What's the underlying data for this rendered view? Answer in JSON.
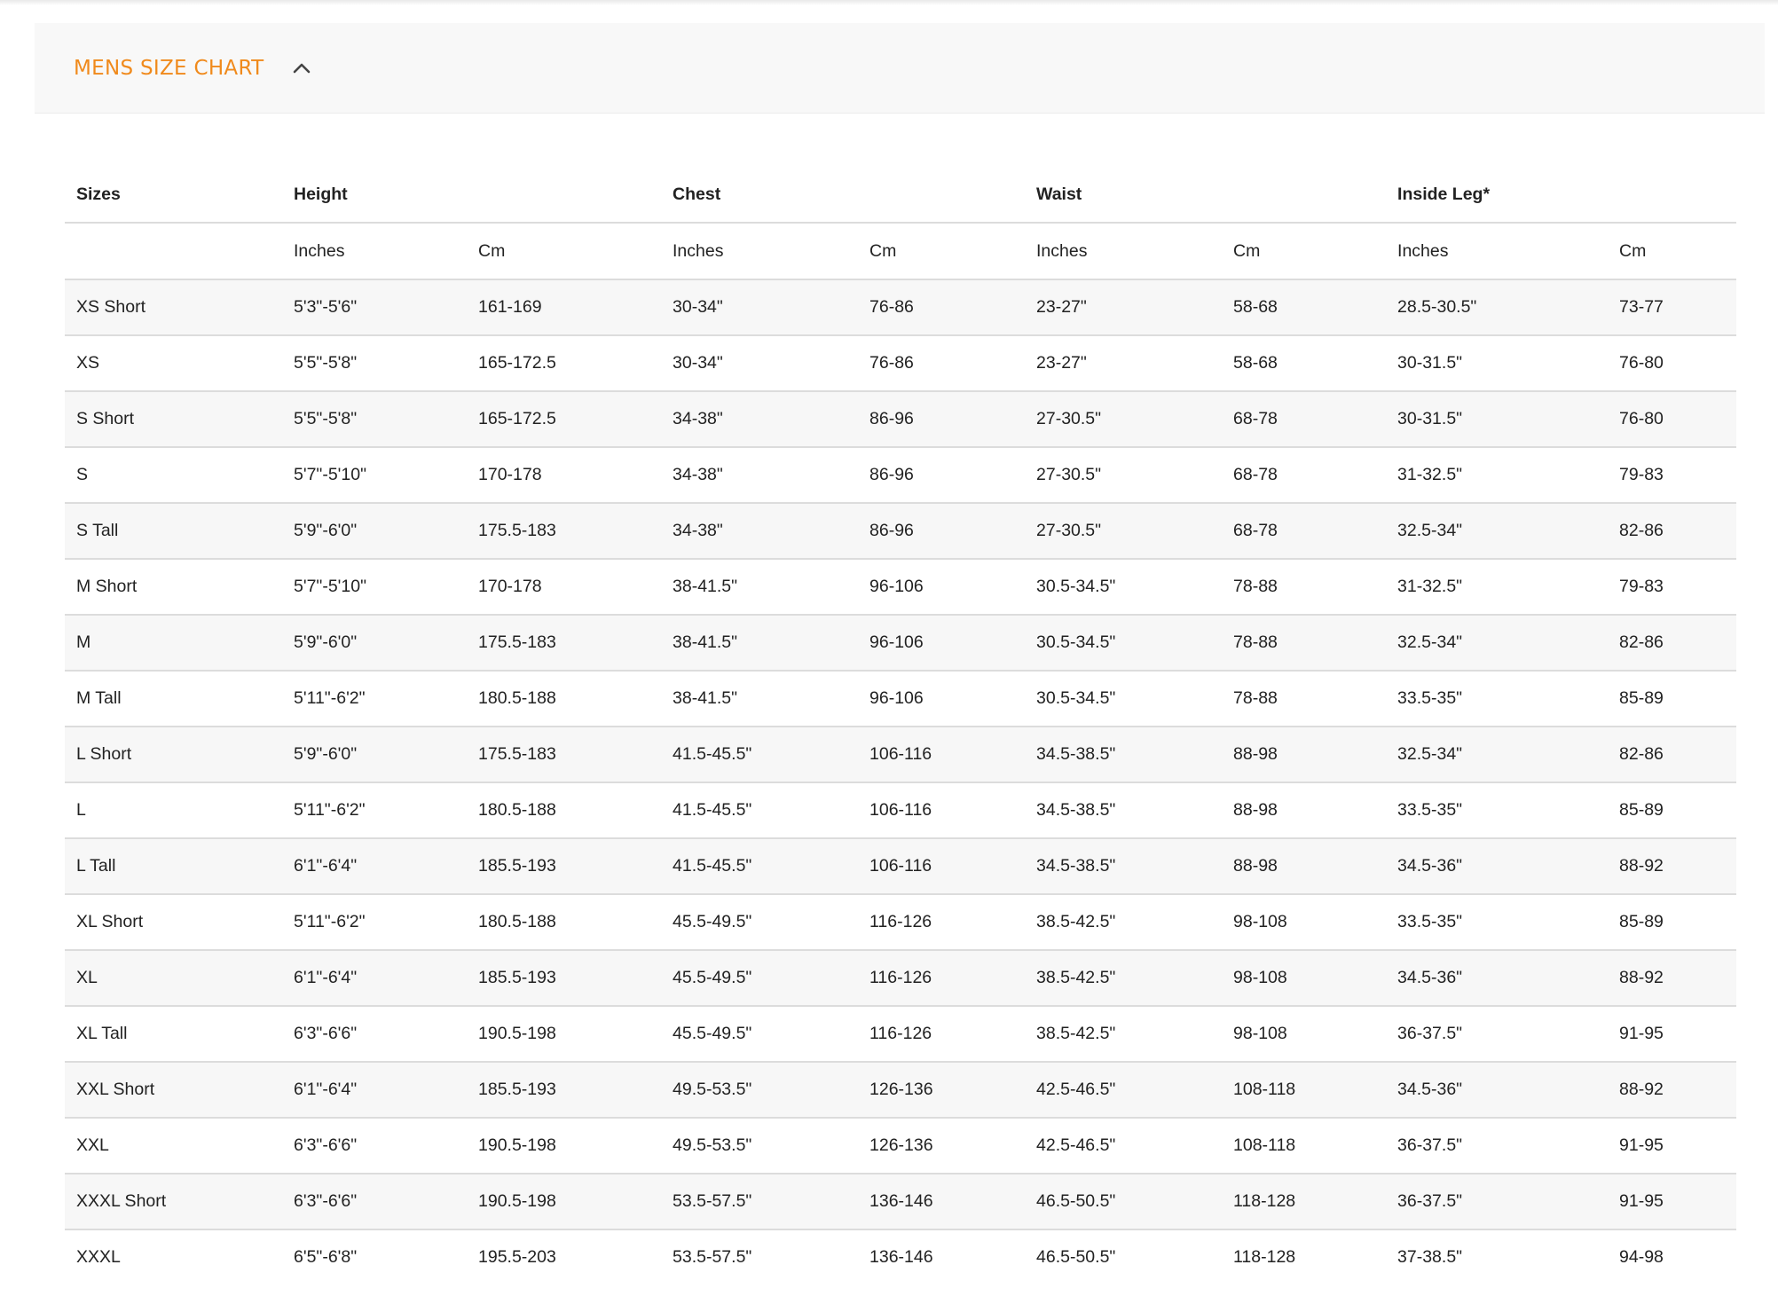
{
  "accordion": {
    "title": "MENS SIZE CHART",
    "expanded_icon": "chevron-up-icon",
    "accent_color": "#f08a1c"
  },
  "table": {
    "headers": {
      "sizes": "Sizes",
      "height": "Height",
      "chest": "Chest",
      "waist": "Waist",
      "inside_leg": "Inside Leg*"
    },
    "units": [
      "",
      "Inches",
      "Cm",
      "Inches",
      "Cm",
      "Inches",
      "Cm",
      "Inches",
      "Cm"
    ],
    "rows": [
      [
        "XS Short",
        "5'3\"-5'6\"",
        "161-169",
        "30-34\"",
        "76-86",
        "23-27\"",
        "58-68",
        "28.5-30.5\"",
        "73-77"
      ],
      [
        "XS",
        "5'5\"-5'8\"",
        "165-172.5",
        "30-34\"",
        "76-86",
        "23-27\"",
        "58-68",
        "30-31.5\"",
        "76-80"
      ],
      [
        "S Short",
        "5'5\"-5'8\"",
        "165-172.5",
        "34-38\"",
        "86-96",
        "27-30.5\"",
        "68-78",
        "30-31.5\"",
        "76-80"
      ],
      [
        "S",
        "5'7\"-5'10\"",
        "170-178",
        "34-38\"",
        "86-96",
        "27-30.5\"",
        "68-78",
        "31-32.5\"",
        "79-83"
      ],
      [
        "S Tall",
        "5'9\"-6'0\"",
        "175.5-183",
        "34-38\"",
        "86-96",
        "27-30.5\"",
        "68-78",
        "32.5-34\"",
        "82-86"
      ],
      [
        "M Short",
        "5'7\"-5'10\"",
        "170-178",
        "38-41.5\"",
        "96-106",
        "30.5-34.5\"",
        "78-88",
        "31-32.5\"",
        "79-83"
      ],
      [
        "M",
        "5'9\"-6'0\"",
        "175.5-183",
        "38-41.5\"",
        "96-106",
        "30.5-34.5\"",
        "78-88",
        "32.5-34\"",
        "82-86"
      ],
      [
        "M Tall",
        "5'11\"-6'2\"",
        "180.5-188",
        "38-41.5\"",
        "96-106",
        "30.5-34.5\"",
        "78-88",
        "33.5-35\"",
        "85-89"
      ],
      [
        "L Short",
        "5'9\"-6'0\"",
        "175.5-183",
        "41.5-45.5\"",
        "106-116",
        "34.5-38.5\"",
        "88-98",
        "32.5-34\"",
        "82-86"
      ],
      [
        "L",
        "5'11\"-6'2\"",
        "180.5-188",
        "41.5-45.5\"",
        "106-116",
        "34.5-38.5\"",
        "88-98",
        "33.5-35\"",
        "85-89"
      ],
      [
        "L Tall",
        "6'1\"-6'4\"",
        "185.5-193",
        "41.5-45.5\"",
        "106-116",
        "34.5-38.5\"",
        "88-98",
        "34.5-36\"",
        "88-92"
      ],
      [
        "XL Short",
        "5'11\"-6'2\"",
        "180.5-188",
        "45.5-49.5\"",
        "116-126",
        "38.5-42.5\"",
        "98-108",
        "33.5-35\"",
        "85-89"
      ],
      [
        "XL",
        "6'1\"-6'4\"",
        "185.5-193",
        "45.5-49.5\"",
        "116-126",
        "38.5-42.5\"",
        "98-108",
        "34.5-36\"",
        "88-92"
      ],
      [
        "XL Tall",
        "6'3\"-6'6\"",
        "190.5-198",
        "45.5-49.5\"",
        "116-126",
        "38.5-42.5\"",
        "98-108",
        "36-37.5\"",
        "91-95"
      ],
      [
        "XXL Short",
        "6'1\"-6'4\"",
        "185.5-193",
        "49.5-53.5\"",
        "126-136",
        "42.5-46.5\"",
        "108-118",
        "34.5-36\"",
        "88-92"
      ],
      [
        "XXL",
        "6'3\"-6'6\"",
        "190.5-198",
        "49.5-53.5\"",
        "126-136",
        "42.5-46.5\"",
        "108-118",
        "36-37.5\"",
        "91-95"
      ],
      [
        "XXXL Short",
        "6'3\"-6'6\"",
        "190.5-198",
        "53.5-57.5\"",
        "136-146",
        "46.5-50.5\"",
        "118-128",
        "36-37.5\"",
        "91-95"
      ],
      [
        "XXXL",
        "6'5\"-6'8\"",
        "195.5-203",
        "53.5-57.5\"",
        "136-146",
        "46.5-50.5\"",
        "118-128",
        "37-38.5\"",
        "94-98"
      ]
    ]
  }
}
